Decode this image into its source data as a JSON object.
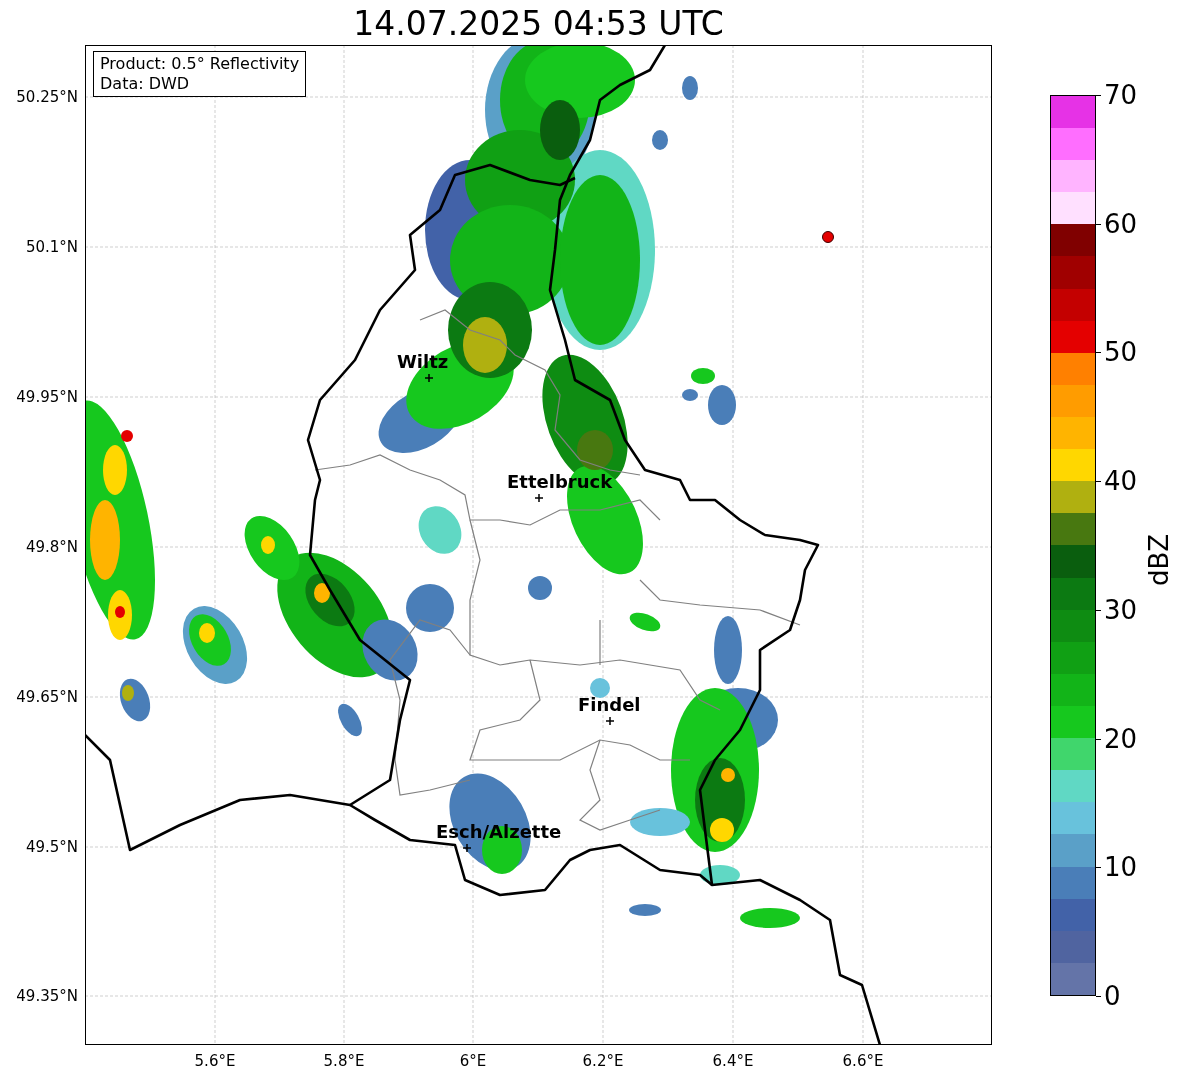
{
  "title": "14.07.2025 04:53 UTC",
  "info_box": [
    "Product: 0.5° Reflectivity",
    "Data: DWD"
  ],
  "y_ticks": [
    "50.25°N",
    "50.1°N",
    "49.95°N",
    "49.8°N",
    "49.65°N",
    "49.5°N",
    "49.35°N"
  ],
  "x_ticks": [
    "5.6°E",
    "5.8°E",
    "6°E",
    "6.2°E",
    "6.4°E",
    "6.6°E"
  ],
  "places": [
    {
      "label": "Wiltz"
    },
    {
      "label": "Ettelbruck"
    },
    {
      "label": "Findel"
    },
    {
      "label": "Esch/Alzette"
    }
  ],
  "colorbar": {
    "label": "dBZ",
    "ticks": [
      "70",
      "60",
      "50",
      "40",
      "30",
      "20",
      "10",
      "0"
    ],
    "bins": [
      {
        "color": "#6474a8"
      },
      {
        "color": "#5064a0"
      },
      {
        "color": "#4262a8"
      },
      {
        "color": "#4a7eb8"
      },
      {
        "color": "#5aa0c8"
      },
      {
        "color": "#68c2dc"
      },
      {
        "color": "#60d8c4"
      },
      {
        "color": "#40d66c"
      },
      {
        "color": "#16c81e"
      },
      {
        "color": "#12b418"
      },
      {
        "color": "#10a014"
      },
      {
        "color": "#0e8c12"
      },
      {
        "color": "#0c7a12"
      },
      {
        "color": "#0a5e0e"
      },
      {
        "color": "#487810"
      },
      {
        "color": "#b0b010"
      },
      {
        "color": "#ffd700"
      },
      {
        "color": "#ffb400"
      },
      {
        "color": "#ff9c00"
      },
      {
        "color": "#ff8000"
      },
      {
        "color": "#e40000"
      },
      {
        "color": "#c40000"
      },
      {
        "color": "#a00000"
      },
      {
        "color": "#800000"
      },
      {
        "color": "#ffe0ff"
      },
      {
        "color": "#ffb4ff"
      },
      {
        "color": "#ff6eff"
      },
      {
        "color": "#e632e6"
      }
    ]
  }
}
